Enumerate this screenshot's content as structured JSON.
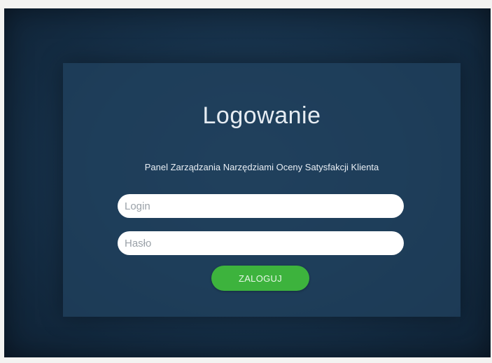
{
  "login_page": {
    "title": "Logowanie",
    "subtitle": "Panel Zarządzania Narzędziami Oceny Satysfakcji Klienta",
    "login_field": {
      "placeholder": "Login",
      "value": ""
    },
    "password_field": {
      "placeholder": "Hasło",
      "value": ""
    },
    "submit_button": {
      "label": "ZALOGUJ"
    }
  },
  "colors": {
    "background": "#17324b",
    "panel": "#214360",
    "button": "#3db33d",
    "input": "#ffffff"
  }
}
